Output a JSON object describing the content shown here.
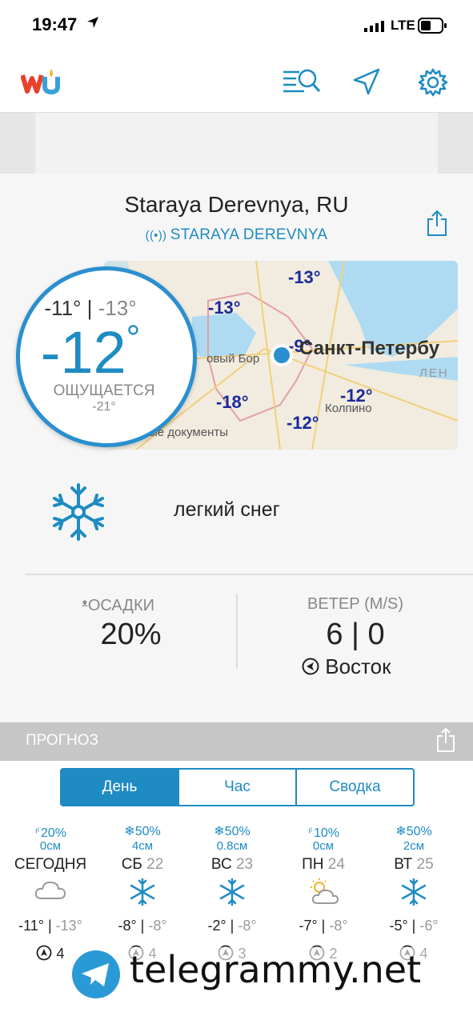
{
  "status": {
    "time": "19:47",
    "network": "LTE"
  },
  "location": {
    "title": "Staraya Derevnya, RU",
    "station": "STARAYA DEREVNYA"
  },
  "current": {
    "high": "-11°",
    "low": "-13°",
    "temp": "-12",
    "deg": "°",
    "feels_label": "ОЩУЩАЕТСЯ",
    "feels_value": "-21°",
    "condition": "легкий снег",
    "condition_icon": "snowflake-icon"
  },
  "map": {
    "temps": [
      "-13°",
      "-13°",
      "-18°",
      "-12°",
      "-12°",
      "-9°"
    ],
    "labels": [
      "Санкт-Петербу",
      "Колпино",
      "овый Бор",
      "ЛЕН",
      "вые документы"
    ]
  },
  "precip": {
    "label": "ОСАДКИ",
    "value": "20%"
  },
  "wind": {
    "label": "ВЕТЕР (M/S)",
    "value": "6 | 0",
    "direction": "Восток"
  },
  "forecast": {
    "title": "ПРОГНОЗ",
    "tabs": [
      "День",
      "Час",
      "Сводка"
    ],
    "days": [
      {
        "precip": "20%",
        "amount": "0см",
        "name": "СЕГОДНЯ",
        "num": "",
        "hi": "-11°",
        "lo": "-13°",
        "wind": "4",
        "icon": "cloud-icon"
      },
      {
        "precip": "50%",
        "amount": "4см",
        "name": "СБ",
        "num": "22",
        "hi": "-8°",
        "lo": "-8°",
        "wind": "4",
        "icon": "snowflake-icon"
      },
      {
        "precip": "50%",
        "amount": "0.8см",
        "name": "ВС",
        "num": "23",
        "hi": "-2°",
        "lo": "-8°",
        "wind": "3",
        "icon": "snowflake-icon"
      },
      {
        "precip": "10%",
        "amount": "0см",
        "name": "ПН",
        "num": "24",
        "hi": "-7°",
        "lo": "-8°",
        "wind": "2",
        "icon": "partly-cloudy-icon"
      },
      {
        "precip": "50%",
        "amount": "2см",
        "name": "ВТ",
        "num": "25",
        "hi": "-5°",
        "lo": "-6°",
        "wind": "4",
        "icon": "snowflake-icon"
      }
    ]
  },
  "watermark": "telegrammy.net",
  "colors": {
    "accent": "#1e8bc3",
    "map_temp": "#1a2a9c"
  }
}
